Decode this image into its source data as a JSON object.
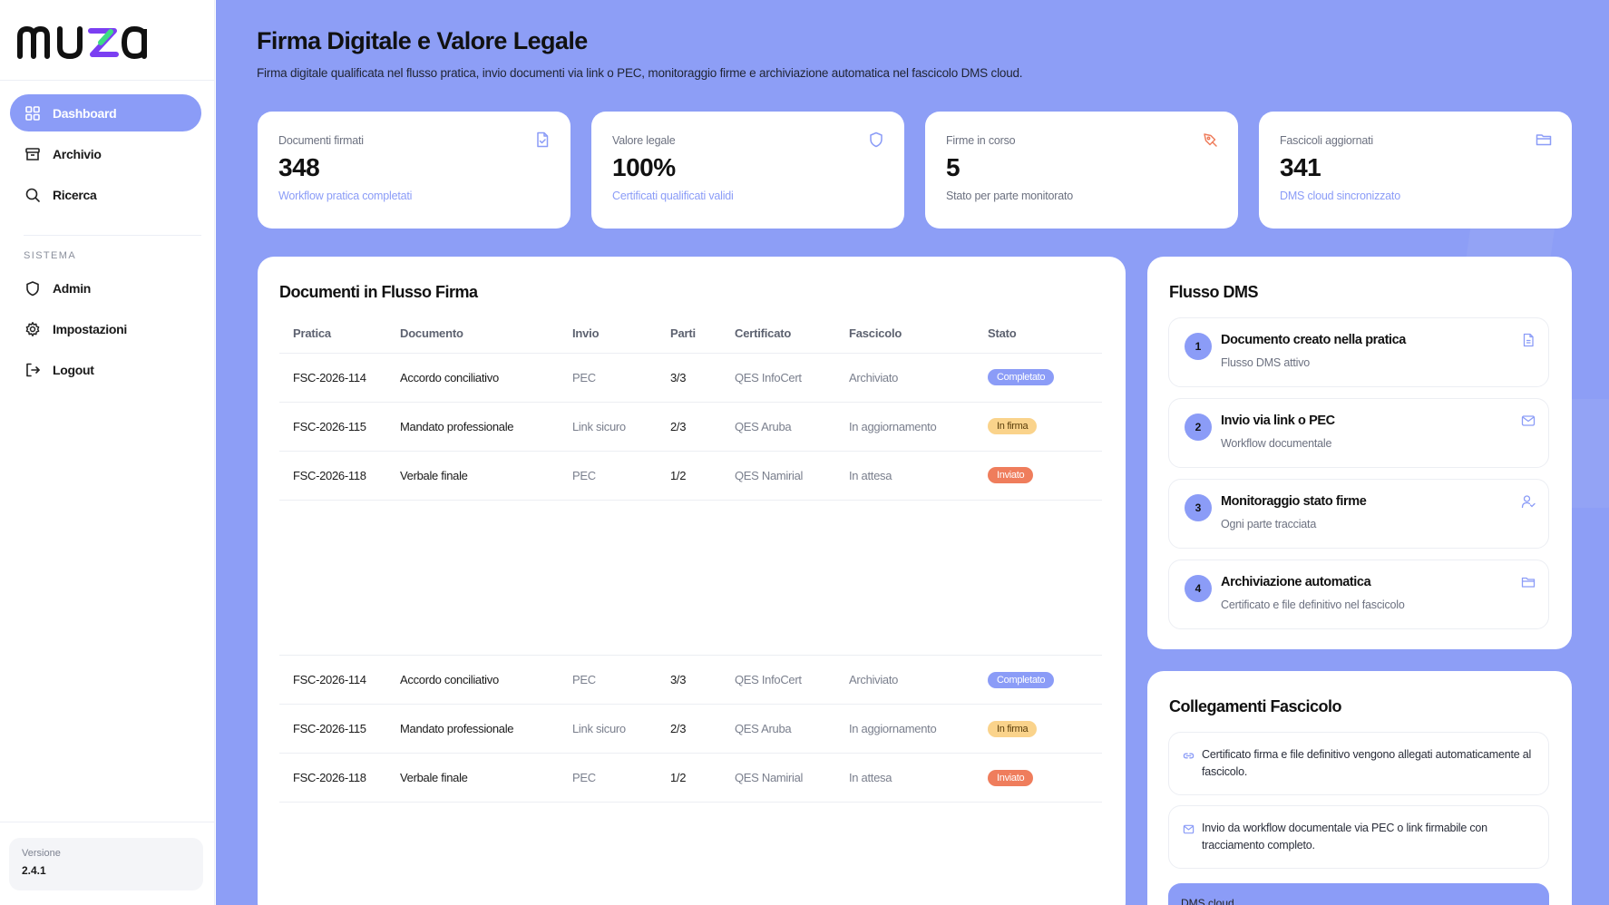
{
  "brand": {
    "logo_text": "muza"
  },
  "sidebar": {
    "nav": [
      {
        "label": "Dashboard",
        "icon": "grid-icon",
        "active": true
      },
      {
        "label": "Archivio",
        "icon": "archive-icon",
        "active": false
      },
      {
        "label": "Ricerca",
        "icon": "search-icon",
        "active": false
      }
    ],
    "section_label": "SISTEMA",
    "system": [
      {
        "label": "Admin",
        "icon": "shield-icon"
      },
      {
        "label": "Impostazioni",
        "icon": "gear-icon"
      },
      {
        "label": "Logout",
        "icon": "logout-icon"
      }
    ],
    "version_label": "Versione",
    "version_value": "2.4.1"
  },
  "header": {
    "title": "Firma Digitale e Valore Legale",
    "subtitle": "Firma digitale qualificata nel flusso pratica, invio documenti via link o PEC, monitoraggio firme e archiviazione automatica nel fascicolo DMS cloud."
  },
  "stats": [
    {
      "label": "Documenti firmati",
      "value": "348",
      "note": "Workflow pratica completati",
      "icon": "document-check-icon"
    },
    {
      "label": "Valore legale",
      "value": "100%",
      "note": "Certificati qualificati validi",
      "icon": "shield-icon"
    },
    {
      "label": "Firme in corso",
      "value": "5",
      "note": "Stato per parte monitorato",
      "icon": "pen-icon"
    },
    {
      "label": "Fascicoli aggiornati",
      "value": "341",
      "note": "DMS cloud sincronizzato",
      "icon": "folder-icon"
    }
  ],
  "documents": {
    "title": "Documenti in Flusso Firma",
    "columns": [
      "Pratica",
      "Documento",
      "Invio",
      "Parti",
      "Certificato",
      "Fascicolo",
      "Stato"
    ],
    "rows": [
      {
        "pratica": "FSC-2026-114",
        "documento": "Accordo conciliativo",
        "invio": "PEC",
        "parti": "3/3",
        "certificato": "QES InfoCert",
        "fascicolo": "Archiviato",
        "stato": "Completato"
      },
      {
        "pratica": "FSC-2026-115",
        "documento": "Mandato professionale",
        "invio": "Link sicuro",
        "parti": "2/3",
        "certificato": "QES Aruba",
        "fascicolo": "In aggiornamento",
        "stato": "In firma"
      },
      {
        "pratica": "FSC-2026-118",
        "documento": "Verbale finale",
        "invio": "PEC",
        "parti": "1/2",
        "certificato": "QES Namirial",
        "fascicolo": "In attesa",
        "stato": "Inviato"
      }
    ],
    "rows_repeat": [
      {
        "pratica": "FSC-2026-114",
        "documento": "Accordo conciliativo",
        "invio": "PEC",
        "parti": "3/3",
        "certificato": "QES InfoCert",
        "fascicolo": "Archiviato",
        "stato": "Completato"
      },
      {
        "pratica": "FSC-2026-115",
        "documento": "Mandato professionale",
        "invio": "Link sicuro",
        "parti": "2/3",
        "certificato": "QES Aruba",
        "fascicolo": "In aggiornamento",
        "stato": "In firma"
      },
      {
        "pratica": "FSC-2026-118",
        "documento": "Verbale finale",
        "invio": "PEC",
        "parti": "1/2",
        "certificato": "QES Namirial",
        "fascicolo": "In attesa",
        "stato": "Inviato"
      }
    ]
  },
  "flow": {
    "title": "Flusso DMS",
    "steps": [
      {
        "num": "1",
        "title": "Documento creato nella pratica",
        "sub": "Flusso DMS attivo",
        "icon": "document-icon"
      },
      {
        "num": "2",
        "title": "Invio via link o PEC",
        "sub": "Workflow documentale",
        "icon": "mail-icon"
      },
      {
        "num": "3",
        "title": "Monitoraggio stato firme",
        "sub": "Ogni parte tracciata",
        "icon": "user-check-icon"
      },
      {
        "num": "4",
        "title": "Archiviazione automatica",
        "sub": "Certificato e file definitivo nel fascicolo",
        "icon": "folder-icon"
      }
    ]
  },
  "links": {
    "title": "Collegamenti Fascicolo",
    "items": [
      {
        "text": "Certificato firma e file definitivo vengono allegati automaticamente al fascicolo.",
        "icon": "link-icon"
      },
      {
        "text": "Invio da workflow documentale via PEC o link firmabile con tracciamento completo.",
        "icon": "mail-icon"
      }
    ],
    "cloud_label": "DMS cloud"
  },
  "colors": {
    "accent": "#8b9cf7",
    "background": "#8d9ef6",
    "badge_done": "#8b9cf7",
    "badge_signing": "#fad38b",
    "badge_sent": "#ef7d5c"
  }
}
